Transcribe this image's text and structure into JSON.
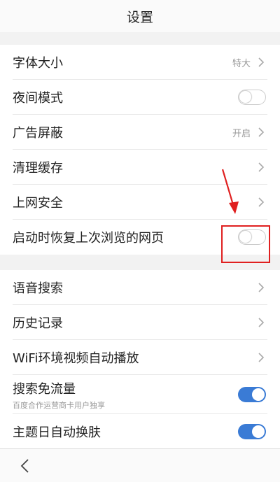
{
  "header": {
    "title": "设置"
  },
  "group1": [
    {
      "label": "字体大小",
      "value": "特大",
      "control": "chevron"
    },
    {
      "label": "夜间模式",
      "control": "toggle",
      "on": false
    },
    {
      "label": "广告屏蔽",
      "value": "开启",
      "control": "chevron"
    },
    {
      "label": "清理缓存",
      "control": "chevron"
    },
    {
      "label": "上网安全",
      "control": "chevron"
    },
    {
      "label": "启动时恢复上次浏览的网页",
      "control": "toggle",
      "on": false
    }
  ],
  "group2": [
    {
      "label": "语音搜索",
      "control": "chevron"
    },
    {
      "label": "历史记录",
      "control": "chevron"
    },
    {
      "label": "WiFi环境视频自动播放",
      "control": "chevron"
    },
    {
      "label": "搜索免流量",
      "sublabel": "百度合作运营商卡用户独享",
      "control": "toggle",
      "on": true
    },
    {
      "label": "主题日自动换肤",
      "control": "toggle",
      "on": true
    }
  ],
  "colors": {
    "accent": "#3a7bd5",
    "annotation": "#e02020"
  },
  "icons": {
    "chevron": "chevron-right-icon",
    "back": "back-arrow-icon"
  }
}
